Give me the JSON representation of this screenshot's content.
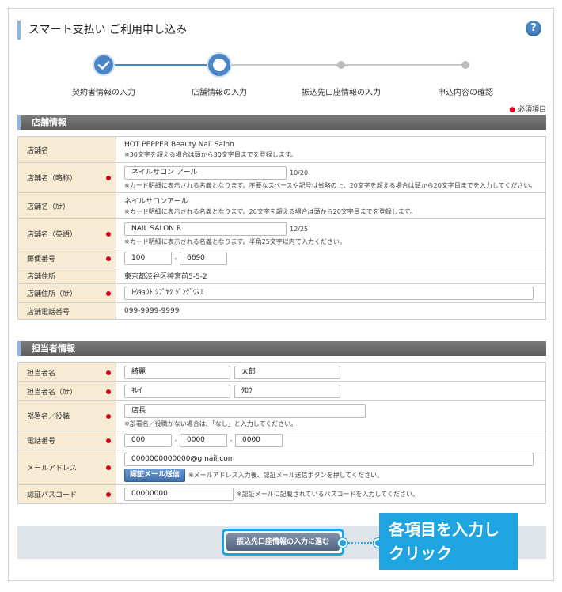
{
  "page": {
    "title": "スマート支払い ご利用申し込み",
    "help_icon": "?",
    "required_note": "必須項目"
  },
  "colors": {
    "accent": "#1ea4e0",
    "step_active": "#4a86c5",
    "step_inactive": "#bdbdbd",
    "required_dot": "#d6001c",
    "label_bg": "#f7ecd3",
    "section_head": "#666666"
  },
  "steps": [
    {
      "label": "契約者情報の入力",
      "state": "done"
    },
    {
      "label": "店舗情報の入力",
      "state": "current"
    },
    {
      "label": "振込先口座情報の入力",
      "state": "todo"
    },
    {
      "label": "申込内容の確認",
      "state": "todo"
    }
  ],
  "store_section": {
    "heading": "店舗情報",
    "store_name": {
      "label": "店舗名",
      "value": "HOT PEPPER Beauty Nail Salon",
      "note": "※30文字を超える場合は頭から30文字目までを登録します。"
    },
    "store_short": {
      "label": "店舗名（略称）",
      "value": "ネイルサロン アール",
      "count": "10/20",
      "note": "※カード明細に表示される名義となります。不要なスペースや記号は省略の上、20文字を超える場合は頭から20文字目までを入力してください。"
    },
    "store_kana": {
      "label": "店舗名（ｶﾅ）",
      "value": "ネイルサロンアール",
      "note": "※カード明細に表示される名義となります。20文字を超える場合は頭から20文字目までを登録します。"
    },
    "store_en": {
      "label": "店舗名（英語）",
      "value": "NAIL SALON R",
      "count": "12/25",
      "note": "※カード明細に表示される名義となります。半角25文字以内で入力ください。"
    },
    "postal": {
      "label": "郵便番号",
      "first": "100",
      "second": "6690"
    },
    "address": {
      "label": "店舗住所",
      "value": "東京都渋谷区神宮前5-5-2"
    },
    "address_kana": {
      "label": "店舗住所（ｶﾅ）",
      "value": "ﾄｳｷｮｳﾄ ｼﾌﾞﾔｸ ｼﾞﾝｸﾞｳﾏｴ"
    },
    "phone": {
      "label": "店舗電話番号",
      "value": "099-9999-9999"
    }
  },
  "contact_section": {
    "heading": "担当者情報",
    "name": {
      "label": "担当者名",
      "last": "綺麗",
      "first": "太郎"
    },
    "name_kana": {
      "label": "担当者名（ｶﾅ）",
      "last": "ｷﾚｲ",
      "first": "ﾀﾛｳ"
    },
    "department": {
      "label": "部署名／役職",
      "value": "店長",
      "note": "※部署名／役職がない場合は、「なし」と入力してください。"
    },
    "phone": {
      "label": "電話番号",
      "p1": "000",
      "p2": "0000",
      "p3": "0000"
    },
    "email": {
      "label": "メールアドレス",
      "value": "0000000000000@gmail.com",
      "button": "認証メール送信",
      "note": "※メールアドレス入力後、認証メール送信ボタンを押してください。"
    },
    "passcode": {
      "label": "認証パスコード",
      "value": "00000000",
      "note": "※認証メールに記載されているパスコードを入力してください。"
    }
  },
  "footer": {
    "next_button": "振込先口座情報の入力に進む",
    "callout_line1": "各項目を入力し",
    "callout_line2": "クリック"
  }
}
